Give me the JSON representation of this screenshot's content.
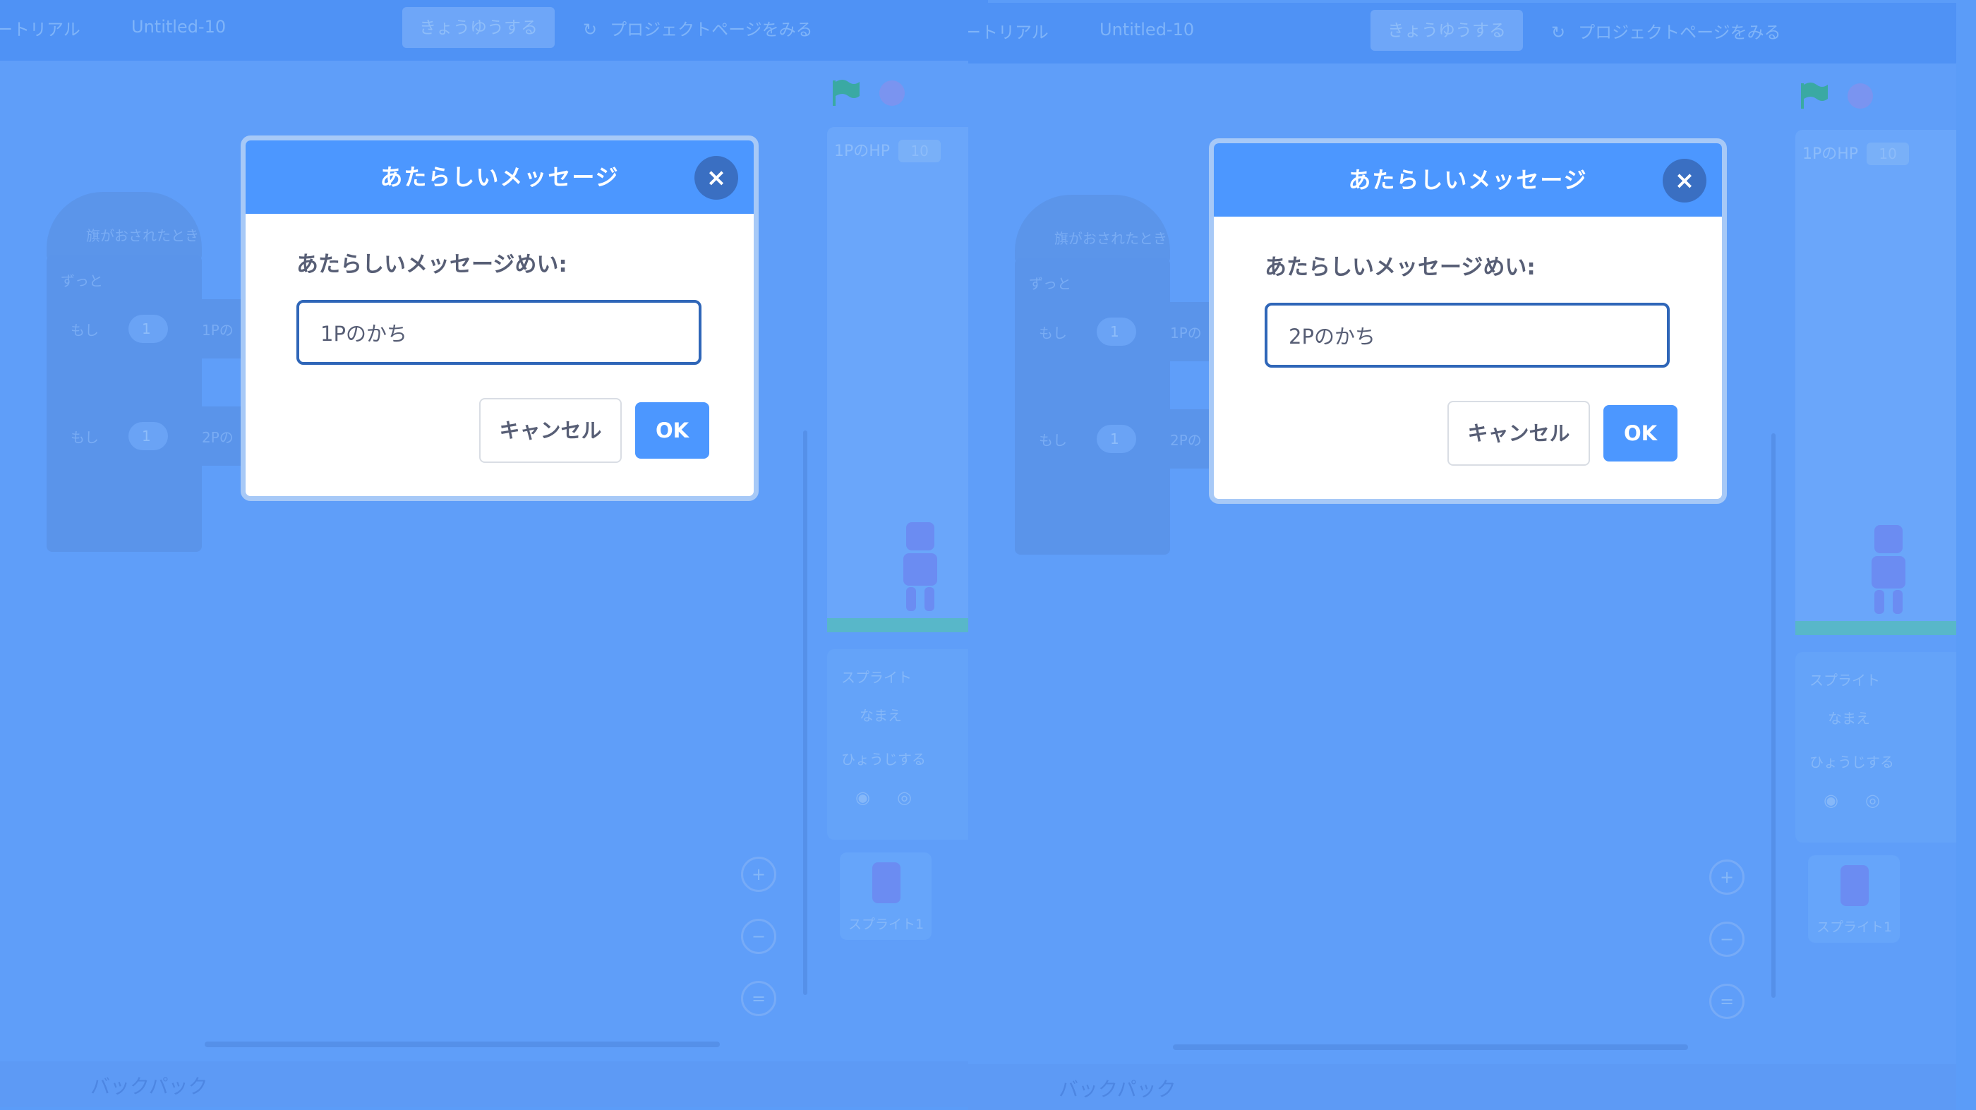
{
  "panels": [
    {
      "menubar": {
        "tutorials": "ートリアル",
        "project_title": "Untitled-10",
        "share_button": "きょうゆうする",
        "see_project_page": "プロジェクトページをみる",
        "see_project_icon": "swirl-icon"
      },
      "code_area": {
        "hat_block": "旗がおされたとき",
        "forever": "ずっと",
        "if_1": "もし",
        "if_2": "もし",
        "pill_1": "1",
        "pill_2": "1",
        "var_1": "1Pの",
        "var_2": "2Pの"
      },
      "stage": {
        "var_monitor_name": "1PのHP",
        "var_monitor_value": "10"
      },
      "sprite_info": {
        "sprite_label": "スプライト",
        "name_label": "なまえ",
        "show_label": "ひょうじする",
        "sprite_tile_label": "スプライト1"
      },
      "backpack": "バックパック",
      "zoom": [
        "+",
        "−",
        "="
      ],
      "dialog": {
        "title": "あたらしいメッセージ",
        "close_icon": "×",
        "prompt": "あたらしいメッセージめい:",
        "input_value": "1Pのかち",
        "cancel": "キャンセル",
        "ok": "OK"
      }
    },
    {
      "menubar": {
        "tutorials": "ートリアル",
        "project_title": "Untitled-10",
        "share_button": "きょうゆうする",
        "see_project_page": "プロジェクトページをみる",
        "see_project_icon": "swirl-icon"
      },
      "code_area": {
        "hat_block": "旗がおされたとき",
        "forever": "ずっと",
        "if_1": "もし",
        "if_2": "もし",
        "pill_1": "1",
        "pill_2": "1",
        "var_1": "1Pの",
        "var_2": "2Pの"
      },
      "stage": {
        "var_monitor_name": "1PのHP",
        "var_monitor_value": "10"
      },
      "sprite_info": {
        "sprite_label": "スプライト",
        "name_label": "なまえ",
        "show_label": "ひょうじする",
        "sprite_tile_label": "スプライト1"
      },
      "backpack": "バックパック",
      "zoom": [
        "+",
        "−",
        "="
      ],
      "dialog": {
        "title": "あたらしいメッセージ",
        "close_icon": "×",
        "prompt": "あたらしいメッセージめい:",
        "input_value": "2Pのかち",
        "cancel": "キャンセル",
        "ok": "OK"
      }
    }
  ],
  "colors": {
    "accent": "#4c97ff",
    "overlay": "#5b9cf8",
    "text": "#575e75"
  }
}
